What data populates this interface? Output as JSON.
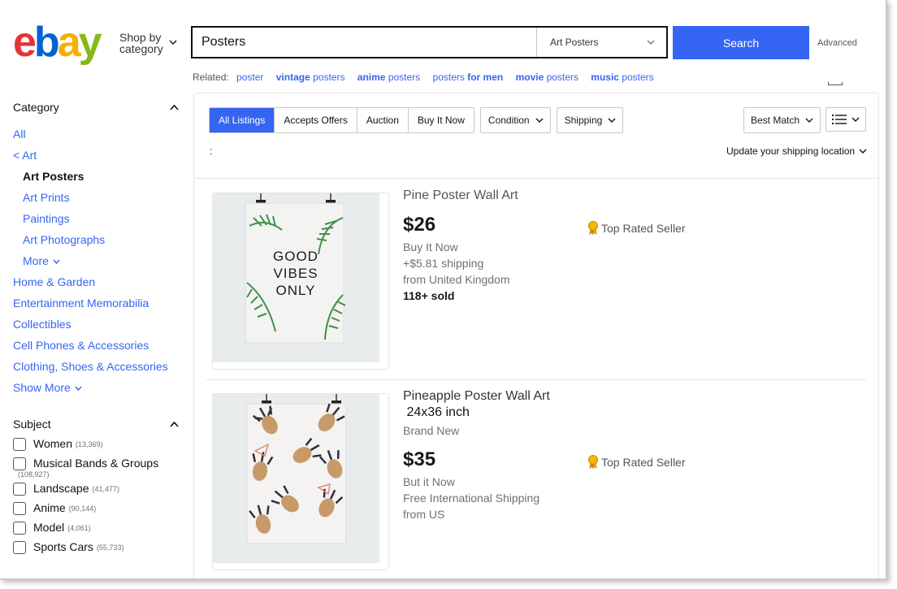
{
  "header": {
    "logo": {
      "e": "e",
      "b": "b",
      "a": "a",
      "y": "y"
    },
    "shop_by_line1": "Shop by",
    "shop_by_line2": "category",
    "search_value": "Posters",
    "category_select": "Art Posters",
    "search_button": "Search",
    "advanced": "Advanced"
  },
  "related": {
    "label": "Related:",
    "links": [
      {
        "plain_before": "",
        "bold": "",
        "plain_after": "poster"
      },
      {
        "plain_before": "",
        "bold": "vintage",
        "plain_after": " posters"
      },
      {
        "plain_before": "",
        "bold": "anime",
        "plain_after": " posters"
      },
      {
        "plain_before": "posters ",
        "bold": "for men",
        "plain_after": ""
      },
      {
        "plain_before": "",
        "bold": "movie",
        "plain_after": " posters"
      },
      {
        "plain_before": "",
        "bold": "music",
        "plain_after": " posters"
      }
    ]
  },
  "sidebar": {
    "category_title": "Category",
    "categories": {
      "all": "All",
      "art": "< Art",
      "art_posters": "Art Posters",
      "art_prints": "Art Prints",
      "paintings": "Paintings",
      "art_photographs": "Art Photographs",
      "more": "More",
      "home_garden": "Home & Garden",
      "entertainment": "Entertainment Memorabilia",
      "collectibles": "Collectibles",
      "cell_phones": "Cell Phones & Accessories",
      "clothing": "Clothing, Shoes & Accessories",
      "show_more": "Show More"
    },
    "subject_title": "Subject",
    "subjects": [
      {
        "label": "Women",
        "count": "(13,369)"
      },
      {
        "label": "Musical Bands & Groups",
        "count": "(108,927)"
      },
      {
        "label": "Landscape",
        "count": "(41,477)"
      },
      {
        "label": "Anime",
        "count": "(90,144)"
      },
      {
        "label": "Model",
        "count": "(4,061)"
      },
      {
        "label": "Sports Cars",
        "count": "(55,733)"
      }
    ]
  },
  "filters": {
    "tabs": [
      "All Listings",
      "Accepts Offers",
      "Auction",
      "Buy It Now"
    ],
    "condition": "Condition",
    "shipping": "Shipping",
    "sort": "Best Match",
    "dot": ":",
    "update_location": "Update your shipping location"
  },
  "items": [
    {
      "title": "Pine Poster Wall Art",
      "price": "$26",
      "format": "Buy It Now",
      "shipping": "+$5.81 shipping",
      "origin": "from United Kingdom",
      "sold": "118+ sold",
      "badge": "Top Rated Seller",
      "poster_text": [
        "GOOD",
        "VIBES",
        "ONLY"
      ]
    },
    {
      "title_line1": "Pineapple Poster Wall Art",
      "title_line2": " 24x36 inch",
      "condition": "Brand New",
      "price": "$35",
      "format": "But it Now",
      "shipping": "Free International Shipping",
      "origin": "from US",
      "badge": "Top Rated Seller"
    }
  ],
  "colors": {
    "accent": "#3665f3",
    "link": "#3665f3",
    "logo_e": "#e53238",
    "logo_b": "#0064d2",
    "logo_a": "#f5af02",
    "logo_y": "#86b817"
  }
}
